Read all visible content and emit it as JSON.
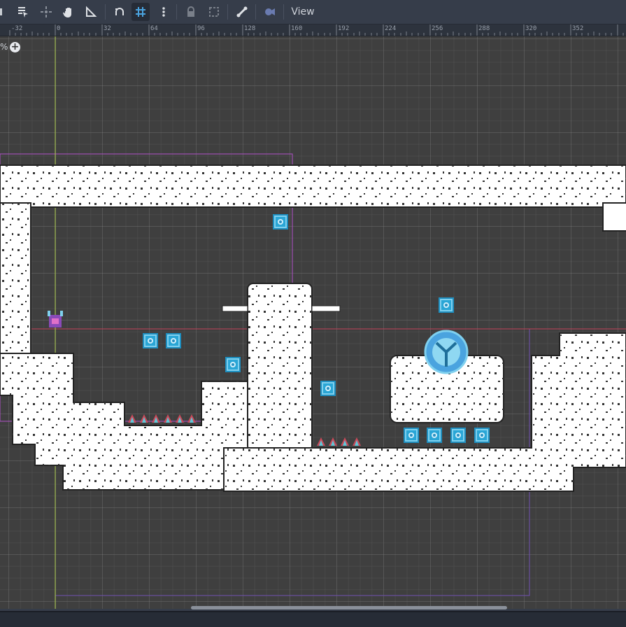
{
  "toolbar": {
    "buttons": [
      {
        "name": "select-tool",
        "icon": "select-list-icon"
      },
      {
        "name": "move-tool",
        "icon": "move-dots-icon"
      },
      {
        "name": "pan-tool",
        "icon": "hand-icon"
      },
      {
        "name": "ruler-tool",
        "icon": "ruler-icon"
      },
      {
        "name": "smart-snap-toggle",
        "icon": "snap-icon"
      },
      {
        "name": "grid-snap-toggle",
        "icon": "grid-snap-icon",
        "active": true
      },
      {
        "name": "more-options",
        "icon": "kebab-icon"
      },
      {
        "name": "lock-button",
        "icon": "lock-icon"
      },
      {
        "name": "group-button",
        "icon": "group-icon"
      },
      {
        "name": "skeleton-button",
        "icon": "bone-icon"
      },
      {
        "name": "camera-override",
        "icon": "camera-icon"
      }
    ],
    "view_label": "View"
  },
  "ruler": {
    "labels": [
      "-32",
      "0",
      "32",
      "64",
      "96",
      "128",
      "160",
      "192",
      "224",
      "256",
      "288",
      "320",
      "352"
    ]
  },
  "zoom": {
    "label": "%"
  },
  "colors": {
    "accent": "#4aa3df",
    "grid_bg": "#3f3f3f",
    "tile_white": "#ffffff",
    "x_axis": "#c0405a",
    "y_axis": "#a8c84a",
    "viewport_rect": "#a050c8"
  }
}
